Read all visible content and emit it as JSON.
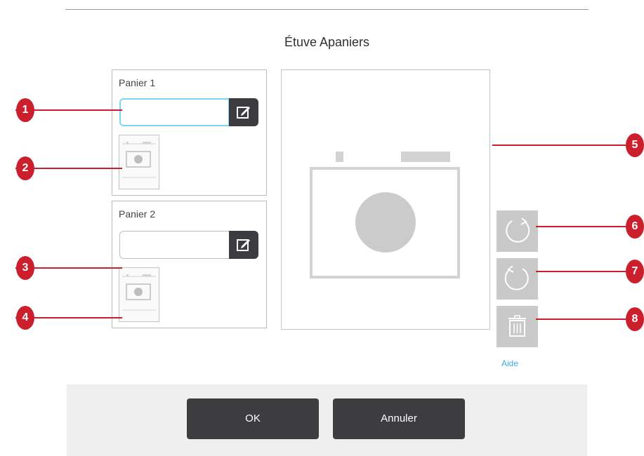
{
  "dialog": {
    "title": "Étuve Apaniers",
    "help_label": "Aide"
  },
  "baskets": [
    {
      "label": "Panier 1",
      "input_value": "",
      "input_focused": true
    },
    {
      "label": "Panier 2",
      "input_value": "",
      "input_focused": false
    }
  ],
  "side_buttons": {
    "rotate_clockwise_icon": "rotate-clockwise-icon",
    "rotate_counterclockwise_icon": "rotate-counterclockwise-icon",
    "delete_icon": "trash-icon"
  },
  "footer": {
    "ok_label": "OK",
    "cancel_label": "Annuler"
  },
  "callouts": {
    "c1": "1",
    "c2": "2",
    "c3": "3",
    "c4": "4",
    "c5": "5",
    "c6": "6",
    "c7": "7",
    "c8": "8"
  },
  "colors": {
    "callout": "#cc1f2e",
    "button_dark": "#3d3d40",
    "focus_ring": "#7fd4f2",
    "link": "#3ea6e2"
  }
}
